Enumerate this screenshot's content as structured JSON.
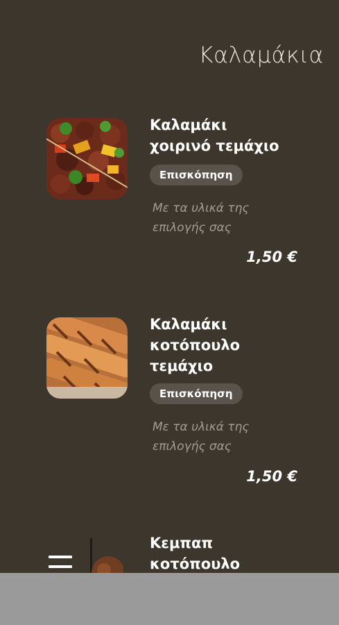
{
  "page": {
    "title": "Καλαμάκια"
  },
  "items": [
    {
      "name_lines": [
        "Καλαμάκι",
        "χοιρινό τεμάχιο"
      ],
      "image_icon": "pork-skewer-photo",
      "button_label": "Επισκόπηση",
      "description_lines": [
        "Με τα υλικά της",
        "επιλογής σας"
      ],
      "price": "1,50 €"
    },
    {
      "name_lines": [
        "Καλαμάκι",
        "κοτόπουλο",
        "τεμάχιο"
      ],
      "image_icon": "chicken-skewer-photo",
      "button_label": "Επισκόπηση",
      "description_lines": [
        "Με τα υλικά της",
        "επιλογής σας"
      ],
      "price": "1,50 €"
    },
    {
      "name_lines": [
        "Κεμπαπ",
        "κοτόπουλο"
      ],
      "image_icon": "kebab-photo"
    }
  ],
  "menu": {
    "icon": "hamburger-menu-icon"
  }
}
